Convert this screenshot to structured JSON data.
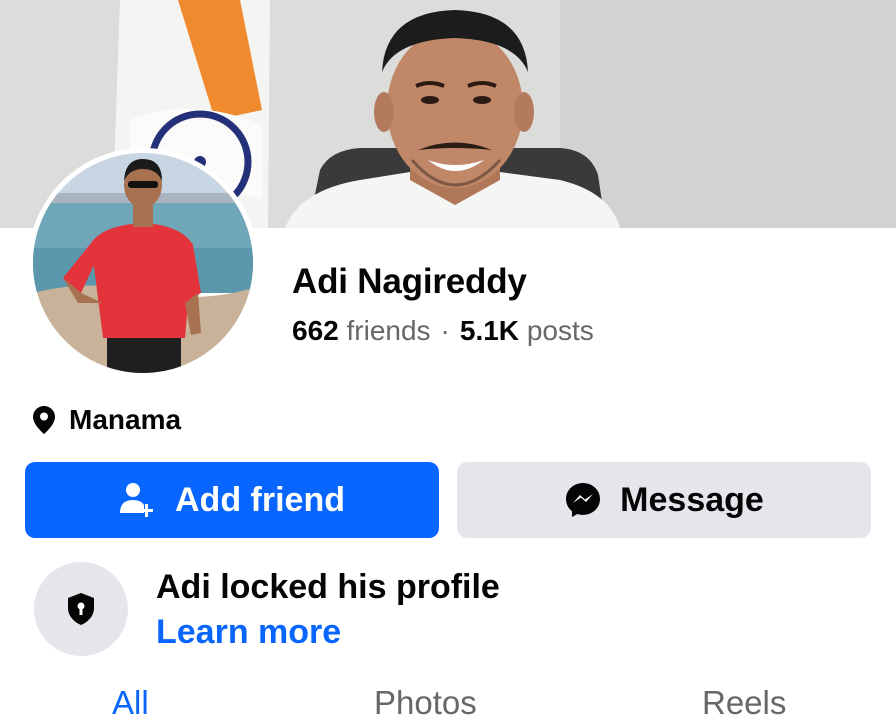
{
  "profile": {
    "name": "Adi Nagireddy",
    "friends_count": "662",
    "friends_label": "friends",
    "separator": "·",
    "posts_count": "5.1K",
    "posts_label": "posts",
    "location": "Manama"
  },
  "actions": {
    "add_friend_label": "Add friend",
    "message_label": "Message"
  },
  "locked": {
    "title": "Adi locked his profile",
    "link": "Learn more"
  },
  "tabs": [
    {
      "label": "All",
      "active": true
    },
    {
      "label": "Photos",
      "active": false
    },
    {
      "label": "Reels",
      "active": false
    }
  ],
  "icons": {
    "location": "location-pin-icon",
    "add_friend": "add-person-icon",
    "message": "messenger-icon",
    "locked": "shield-lock-icon"
  },
  "colors": {
    "primary": "#0866ff",
    "secondary_button": "#e4e6eb",
    "text": "#050505",
    "muted_text": "#65676b"
  }
}
